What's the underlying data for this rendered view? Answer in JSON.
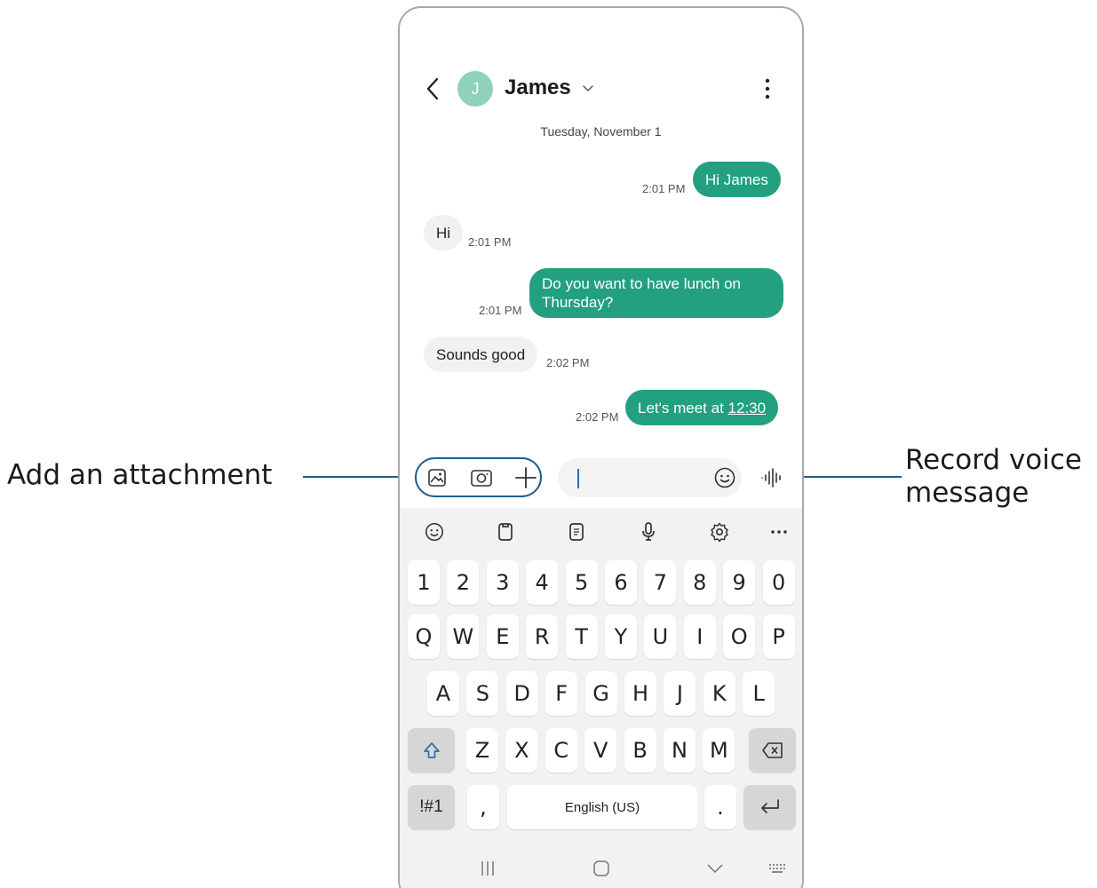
{
  "callouts": {
    "left": "Add an attachment",
    "right_line1": "Record voice",
    "right_line2": "message"
  },
  "header": {
    "contact_name": "James",
    "avatar_initial": "J",
    "back_icon": "chevron-left-icon",
    "dropdown_icon": "chevron-down-icon",
    "menu_icon": "more-vertical-icon"
  },
  "conversation": {
    "date": "Tuesday, November 1",
    "messages": [
      {
        "direction": "out",
        "text": "Hi James",
        "time": "2:01 PM"
      },
      {
        "direction": "in",
        "text": "Hi",
        "time": "2:01 PM"
      },
      {
        "direction": "out",
        "line1": "Do you want to have lunch on",
        "line2": "Thursday?",
        "time": "2:01 PM"
      },
      {
        "direction": "in",
        "text": "Sounds good",
        "time": "2:02 PM"
      },
      {
        "direction": "out",
        "text_prefix": "Let's meet at ",
        "link": "12:30",
        "time": "2:02 PM"
      }
    ]
  },
  "composer": {
    "attachment_icons": [
      "gallery-icon",
      "camera-icon",
      "plus-icon"
    ],
    "emoji_icon": "emoji-icon",
    "voice_icon": "voice-waveform-icon",
    "input_value": ""
  },
  "keyboard": {
    "toolbar": [
      "emoji-icon",
      "clipboard-icon",
      "text-editor-icon",
      "microphone-icon",
      "settings-icon",
      "more-horizontal-icon"
    ],
    "row_numbers": [
      "1",
      "2",
      "3",
      "4",
      "5",
      "6",
      "7",
      "8",
      "9",
      "0"
    ],
    "row1": [
      "Q",
      "W",
      "E",
      "R",
      "T",
      "Y",
      "U",
      "I",
      "O",
      "P"
    ],
    "row2": [
      "A",
      "S",
      "D",
      "F",
      "G",
      "H",
      "J",
      "K",
      "L"
    ],
    "row3": [
      "Z",
      "X",
      "C",
      "V",
      "B",
      "N",
      "M"
    ],
    "symbols_key": "!#1",
    "comma_key": ",",
    "space_label": "English (US)",
    "period_key": ".",
    "shift_icon": "shift-icon",
    "backspace_icon": "backspace-icon",
    "enter_icon": "enter-icon"
  },
  "navbar": [
    "recents-icon",
    "home-icon",
    "back-down-icon",
    "keyboard-switch-icon"
  ],
  "colors": {
    "accent": "#23a07f",
    "callout_line": "#1f5f8f",
    "incoming_bubble": "#f1f1f1",
    "keyboard_bg": "#f2f2f2"
  }
}
